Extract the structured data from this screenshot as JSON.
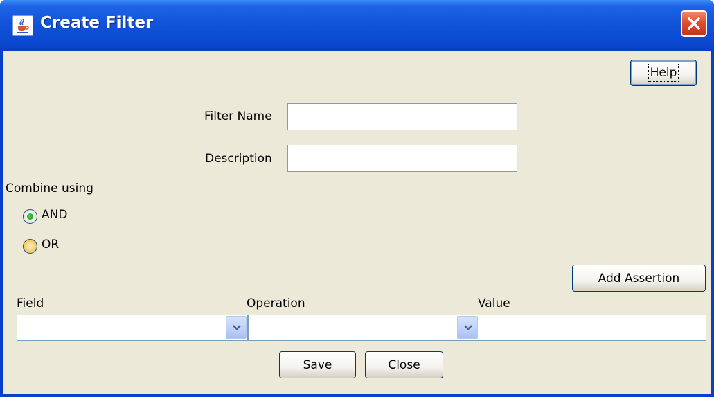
{
  "window": {
    "title": "Create Filter",
    "icon": "java-cup-icon",
    "close_icon": "close-x-icon"
  },
  "toolbar": {
    "help_label": "Help"
  },
  "form": {
    "filter_name_label": "Filter Name",
    "filter_name_value": "",
    "description_label": "Description",
    "description_value": ""
  },
  "combine": {
    "label": "Combine using",
    "options": [
      {
        "label": "AND",
        "selected": true
      },
      {
        "label": "OR",
        "selected": false
      }
    ]
  },
  "assertion": {
    "add_label": "Add Assertion",
    "columns": [
      "Field",
      "Operation",
      "Value"
    ],
    "field_value": "",
    "operation_value": "",
    "value_value": ""
  },
  "footer": {
    "save_label": "Save",
    "close_label": "Close"
  },
  "colors": {
    "titlebar": "#0a48cf",
    "panel": "#ece9d8",
    "close_button": "#e0492a",
    "field_border": "#7f9db9"
  }
}
